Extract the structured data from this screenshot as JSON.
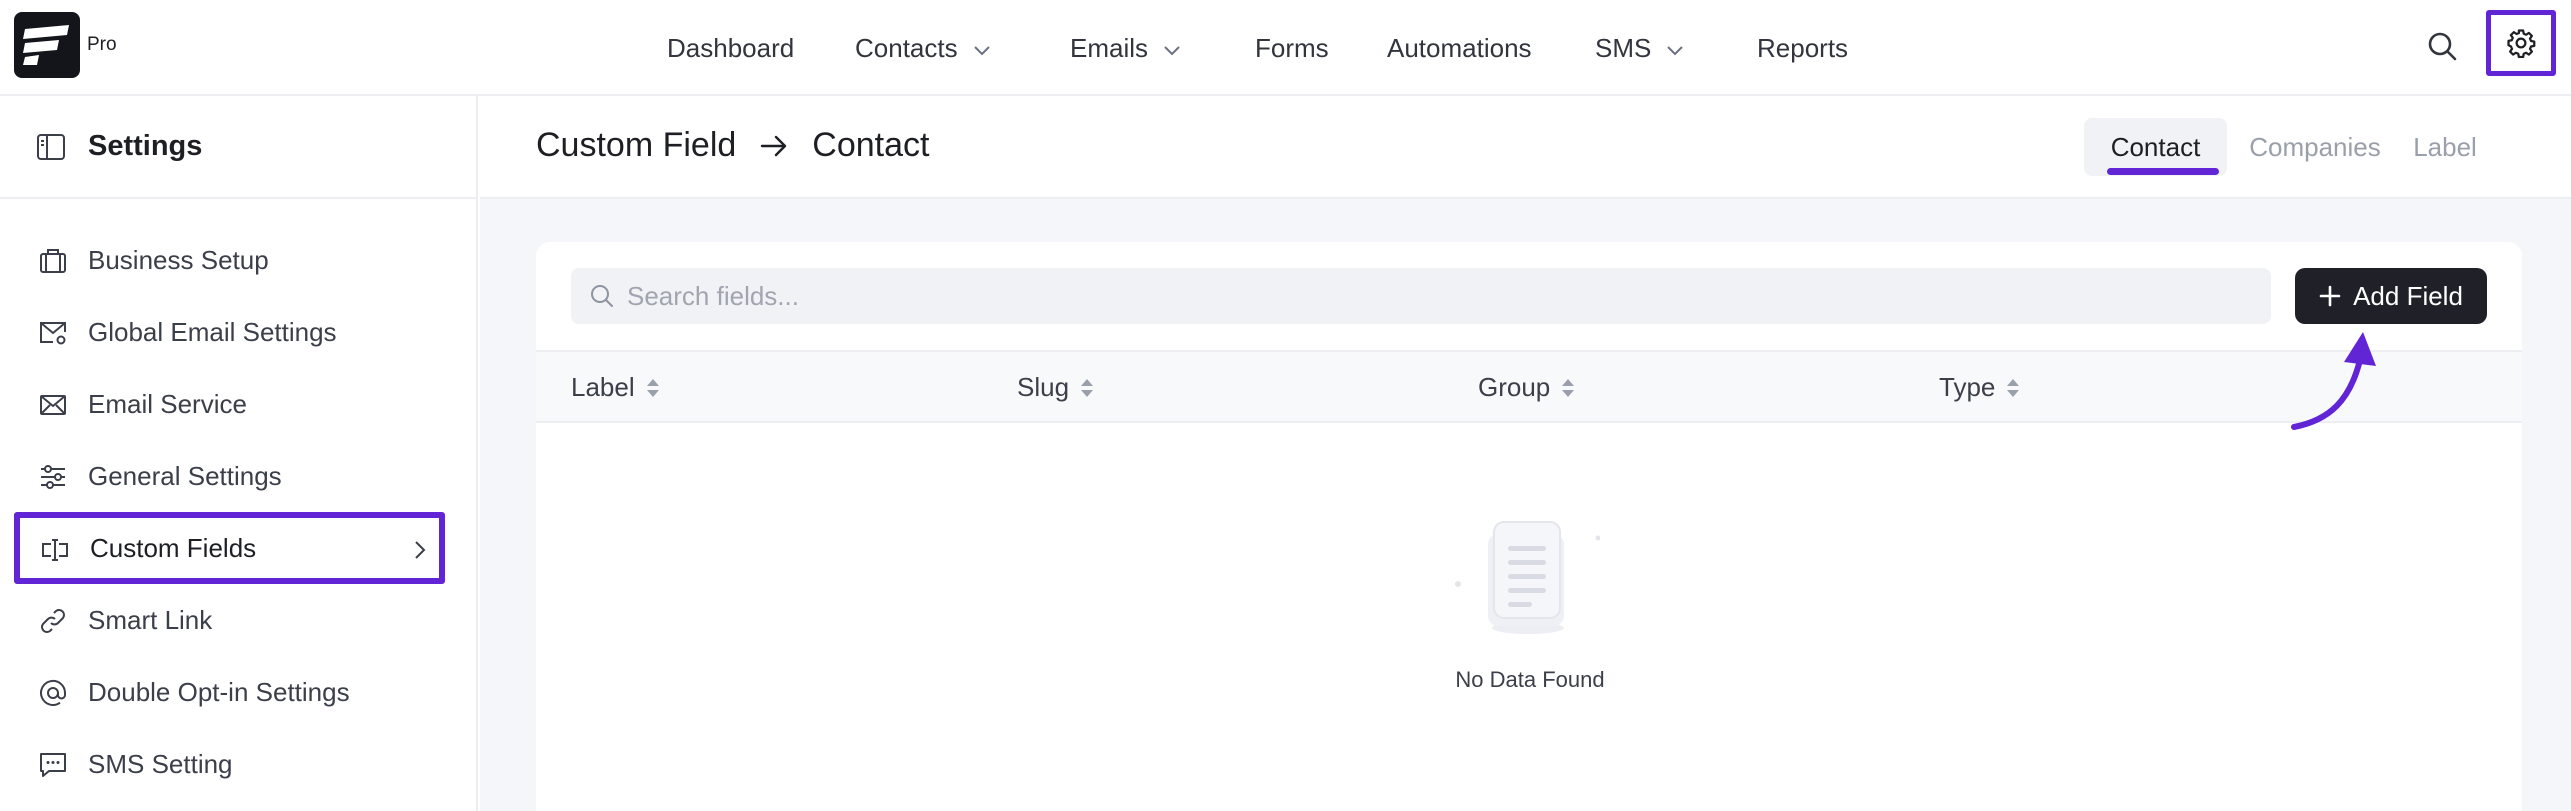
{
  "brand": {
    "badge": "Pro"
  },
  "nav": {
    "items": [
      {
        "label": "Dashboard"
      },
      {
        "label": "Contacts"
      },
      {
        "label": "Emails"
      },
      {
        "label": "Forms"
      },
      {
        "label": "Automations"
      },
      {
        "label": "SMS"
      },
      {
        "label": "Reports"
      }
    ]
  },
  "sidebar": {
    "title": "Settings",
    "items": [
      {
        "label": "Business Setup",
        "icon": "briefcase-icon"
      },
      {
        "label": "Global Email Settings",
        "icon": "mail-settings-icon"
      },
      {
        "label": "Email Service",
        "icon": "mail-send-icon"
      },
      {
        "label": "General Settings",
        "icon": "sliders-icon"
      },
      {
        "label": "Custom Fields",
        "icon": "text-field-icon",
        "active": true
      },
      {
        "label": "Smart Link",
        "icon": "link-icon"
      },
      {
        "label": "Double Opt-in Settings",
        "icon": "at-icon"
      },
      {
        "label": "SMS Setting",
        "icon": "message-icon"
      }
    ]
  },
  "main": {
    "breadcrumb": {
      "parent": "Custom Field",
      "current": "Contact"
    },
    "tabs": [
      {
        "label": "Contact",
        "active": true
      },
      {
        "label": "Companies"
      },
      {
        "label": "Label"
      }
    ],
    "search": {
      "placeholder": "Search fields...",
      "value": ""
    },
    "add_button": "Add Field",
    "table": {
      "columns": [
        "Label",
        "Slug",
        "Group",
        "Type"
      ],
      "rows": [],
      "empty_text": "No Data Found"
    }
  },
  "colors": {
    "highlight": "#6225d6",
    "primary_button": "#1f2028"
  }
}
